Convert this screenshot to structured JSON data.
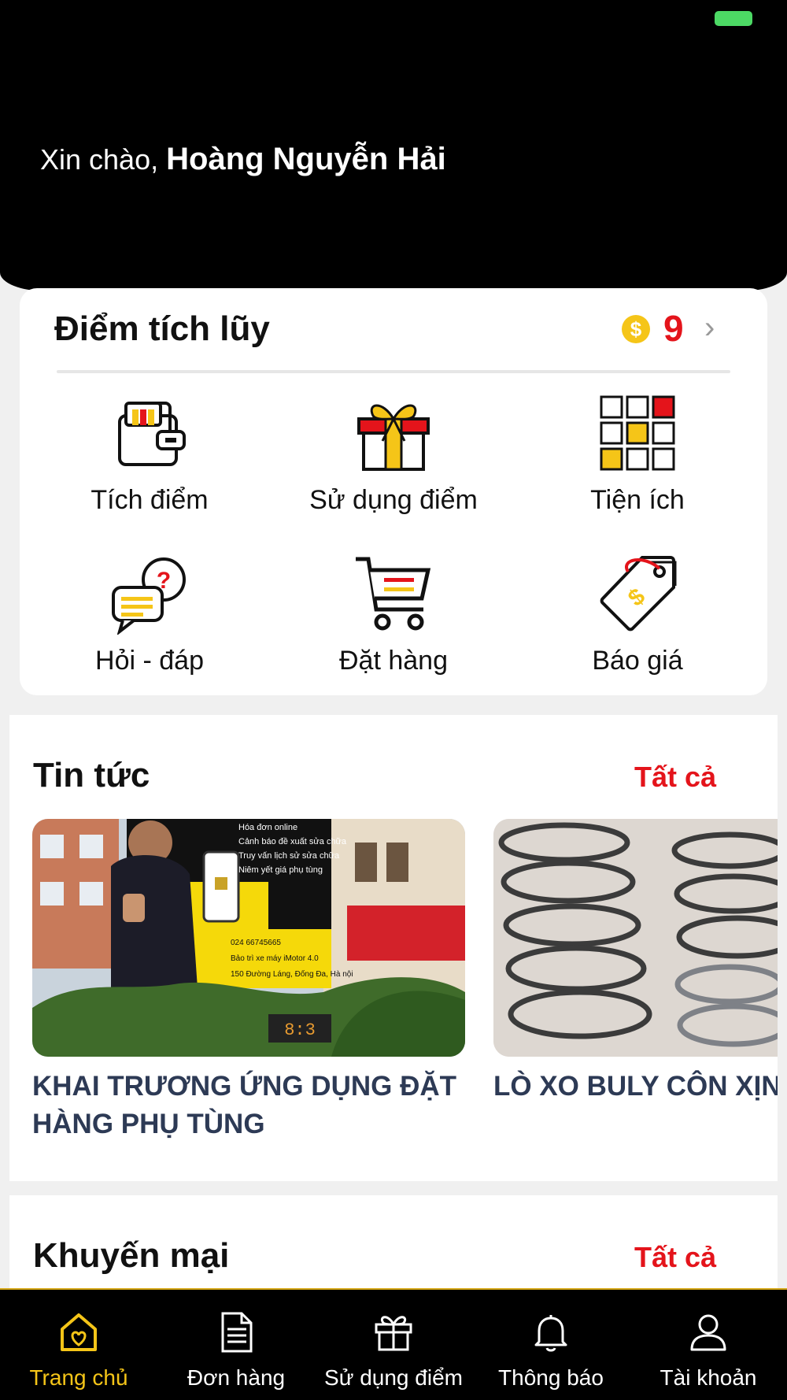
{
  "header": {
    "greeting_prefix": "Xin chào,",
    "user_name": "Hoàng Nguyễn Hải"
  },
  "points": {
    "title": "Điểm tích lũy",
    "coin_symbol": "$",
    "value": "9",
    "arrow": "›"
  },
  "features": [
    {
      "label": "Tích điểm",
      "icon": "wallet-icon"
    },
    {
      "label": "Sử dụng điểm",
      "icon": "gift-icon"
    },
    {
      "label": "Tiện ích",
      "icon": "grid-icon"
    },
    {
      "label": "Hỏi - đáp",
      "icon": "chat-question-icon"
    },
    {
      "label": "Đặt hàng",
      "icon": "cart-icon"
    },
    {
      "label": "Báo giá",
      "icon": "price-tag-icon"
    }
  ],
  "news": {
    "title": "Tin tức",
    "see_all": "Tất cả",
    "items": [
      {
        "caption": "KHAI TRƯƠNG ỨNG DỤNG ĐẶT HÀNG PHỤ TÙNG",
        "banner_lines": [
          "Hóa đơn online",
          "Cảnh báo đề xuất sửa chữa",
          "Truy vấn lịch sử sửa chữa",
          "Niêm yết giá phụ tùng"
        ],
        "banner_contacts": [
          "024 66745665",
          "Bảo trì xe máy iMotor 4.0",
          "150 Đường Láng, Đống Đa, Hà nội"
        ]
      },
      {
        "caption": "LÒ XO BULY CÔN XỊN"
      }
    ]
  },
  "promotions": {
    "title": "Khuyến mại",
    "see_all": "Tất cả"
  },
  "tabbar": [
    {
      "label": "Trang chủ",
      "icon": "home-heart-icon",
      "active": true
    },
    {
      "label": "Đơn hàng",
      "icon": "document-icon",
      "active": false
    },
    {
      "label": "Sử dụng điểm",
      "icon": "gift-icon",
      "active": false
    },
    {
      "label": "Thông báo",
      "icon": "bell-icon",
      "active": false
    },
    {
      "label": "Tài khoản",
      "icon": "user-icon",
      "active": false
    }
  ],
  "colors": {
    "accent_red": "#e4141b",
    "accent_yellow": "#f5c518",
    "header_bg": "#000000",
    "caption_navy": "#2d3a55"
  }
}
